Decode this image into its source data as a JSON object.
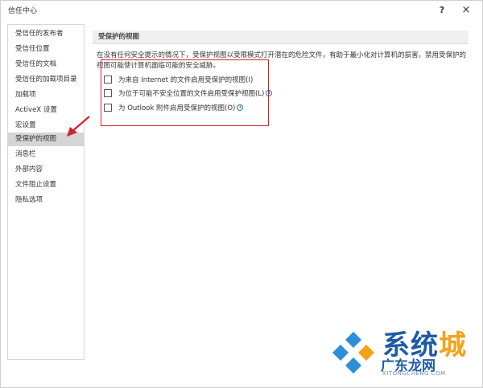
{
  "window": {
    "title": "信任中心",
    "help_label": "?",
    "close_label": "×"
  },
  "sidebar": {
    "items": [
      {
        "label": "受信任的发布者"
      },
      {
        "label": "受信任位置"
      },
      {
        "label": "受信任的文档"
      },
      {
        "label": "受信任的加载项目录"
      },
      {
        "label": "加载项"
      },
      {
        "label": "ActiveX 设置"
      },
      {
        "label": "宏设置"
      },
      {
        "label": "受保护的视图",
        "selected": true
      },
      {
        "label": "消息栏"
      },
      {
        "label": "外部内容"
      },
      {
        "label": "文件阻止设置"
      },
      {
        "label": "隐私选项"
      }
    ]
  },
  "main": {
    "section_title": "受保护的视图",
    "description": "在没有任何安全提示的情况下，受保护视图以受限模式打开潜在的危险文件，有助于最小化对计算机的损害。禁用受保护的视图可能使计算机面临可能的安全威胁。",
    "options": [
      {
        "label": "为来自 Internet 的文件启用受保护的视图(I)",
        "checked": false,
        "info": false
      },
      {
        "label": "为位于可能不安全位置的文件启用受保护视图(L)",
        "checked": false,
        "info": true
      },
      {
        "label": "为 Outlook 附件启用受保护的视图(O)",
        "checked": false,
        "info": true
      }
    ]
  },
  "watermark": {
    "brand_1": "系统",
    "brand_2": "城",
    "subtitle": "广东龙网",
    "url": "XITONGCHENG.COM"
  },
  "colors": {
    "highlight": "#d3232a",
    "selected_bg": "#d5d5d5",
    "brand_blue": "#1e5aa6",
    "brand_orange": "#f6a01a"
  }
}
